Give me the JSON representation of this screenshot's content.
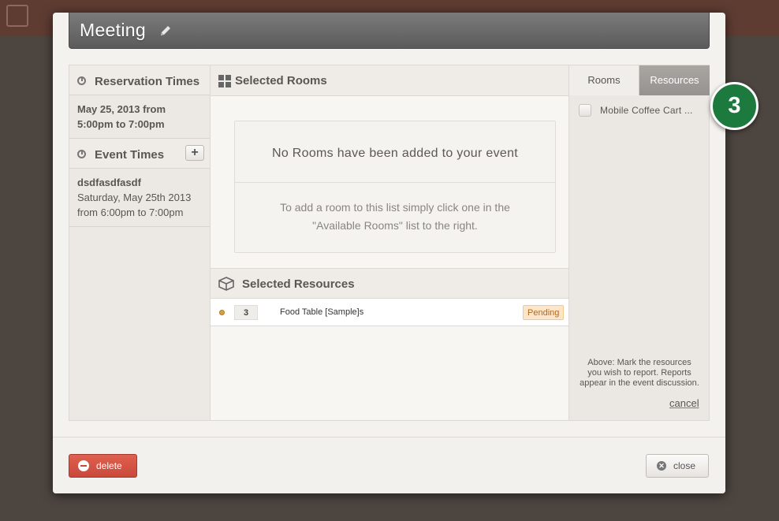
{
  "modal": {
    "title": "Meeting",
    "reservation_times": {
      "label": "Reservation Times",
      "value_line1": "May 25, 2013 from",
      "value_line2": "5:00pm to 7:00pm"
    },
    "event_times": {
      "label": "Event Times",
      "add_label": "+",
      "event_name": "dsdfasdfasdf",
      "event_line1": "Saturday, May 25th 2013",
      "event_line2": "from 6:00pm to 7:00pm"
    },
    "selected_rooms": {
      "label": "Selected Rooms",
      "empty_title": "No Rooms have been added to your event",
      "empty_desc_line1": "To add a room to this list simply click one in the",
      "empty_desc_line2": "\"Available Rooms\" list to the right."
    },
    "selected_resources": {
      "label": "Selected Resources",
      "items": [
        {
          "qty": "3",
          "name": "Food Table [Sample]s",
          "status": "Pending"
        }
      ]
    },
    "right_panel": {
      "tabs": [
        "Rooms",
        "Resources"
      ],
      "active_tab": "Resources",
      "items": [
        {
          "label": "Mobile Coffee Cart ...",
          "checked": false
        }
      ],
      "note_line1": "Above: Mark the resources",
      "note_line2": "you wish to report. Reports",
      "note_line3": "appear in the event discussion.",
      "cancel_label": "cancel"
    },
    "footer": {
      "delete_label": "delete",
      "close_label": "close"
    }
  },
  "step_badge": "3",
  "colors": {
    "delete": "#d4523f",
    "badge": "#1c7a3e",
    "pending_bg": "#fce5c8",
    "active_tab": "#a09d99"
  }
}
